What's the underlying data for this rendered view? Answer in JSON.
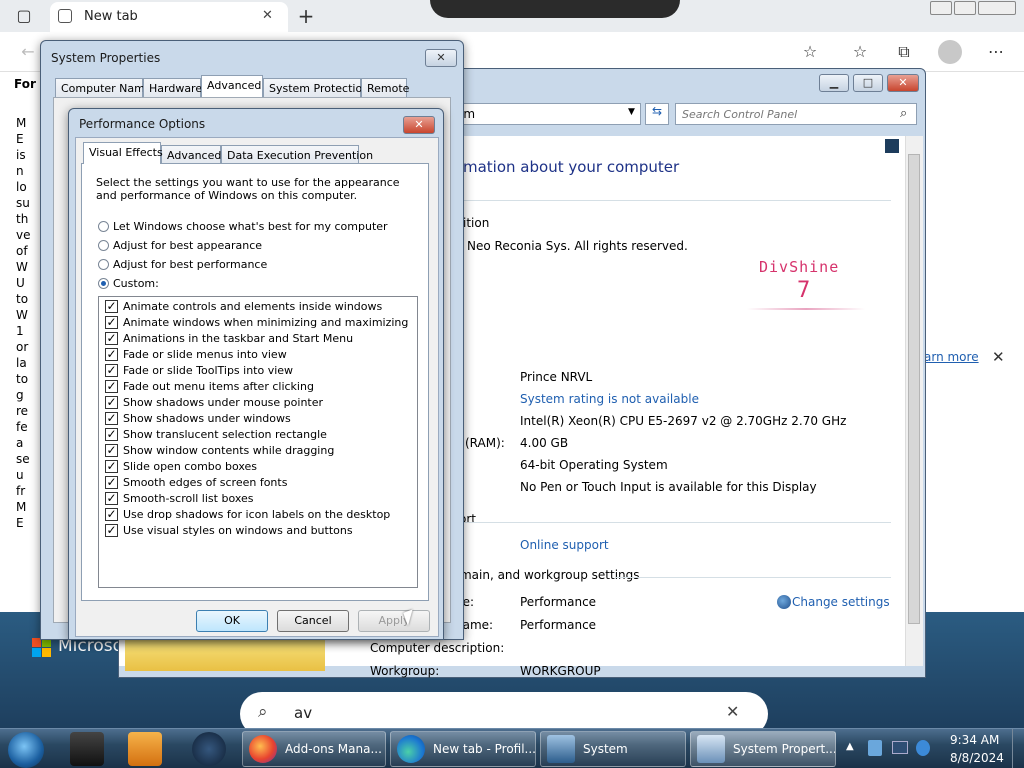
{
  "browser": {
    "tab_title": "New tab",
    "tab_close": "✕",
    "new_tab": "+",
    "favbar_text": "For c",
    "left_column": [
      "M",
      "E",
      "is",
      "n",
      "lo",
      "su",
      "th",
      "ve",
      "of",
      "W",
      "U",
      "to",
      "W",
      "1",
      "or",
      "la",
      "to",
      "g",
      "re",
      "fe",
      "a",
      "se",
      "u",
      "fr",
      "M",
      "E"
    ],
    "learn_more": "arn more",
    "close_x": "✕",
    "banner_brand": "Microso",
    "search_query": "av"
  },
  "control_panel": {
    "search_placeholder": "Search Control Panel",
    "address_fragment": "em",
    "heading": "mation about your computer",
    "edition_label": "ition",
    "copyright": "Neo Reconia Sys.  All rights reserved.",
    "logo_text": "DivShine",
    "logo_version": "7",
    "rows": [
      {
        "label": "",
        "value": "Prince NRVL",
        "link": false
      },
      {
        "label": "",
        "value": "System rating is not available",
        "link": true
      },
      {
        "label": "",
        "value": "Intel(R) Xeon(R) CPU E5-2697 v2 @ 2.70GHz   2.70 GHz",
        "link": false
      },
      {
        "label": "(RAM):",
        "value": "4.00 GB",
        "link": false
      },
      {
        "label": "",
        "value": "64-bit Operating System",
        "link": false
      },
      {
        "label": "",
        "value": "No Pen or Touch Input is available for this Display",
        "link": false
      }
    ],
    "support_label": "ort",
    "online_support": "Online support",
    "domain_section": "domain, and workgroup settings",
    "name_rows": [
      {
        "label": "ne:",
        "value": "Performance"
      },
      {
        "label": "name:",
        "value": "Performance"
      },
      {
        "label": "Computer description:",
        "value": ""
      },
      {
        "label": "Workgroup:",
        "value": "WORKGROUP"
      }
    ],
    "change_settings": "Change settings"
  },
  "system_properties": {
    "title": "System Properties",
    "tabs": [
      "Computer Name",
      "Hardware",
      "Advanced",
      "System Protection",
      "Remote"
    ],
    "selected_tab": "Advanced"
  },
  "performance_options": {
    "title": "Performance Options",
    "tabs": [
      "Visual Effects",
      "Advanced",
      "Data Execution Prevention"
    ],
    "selected_tab": "Visual Effects",
    "description": "Select the settings you want to use for the appearance and performance of Windows on this computer.",
    "radios": [
      {
        "label": "Let Windows choose what's best for my computer",
        "checked": false
      },
      {
        "label": "Adjust for best appearance",
        "checked": false
      },
      {
        "label": "Adjust for best performance",
        "checked": false
      },
      {
        "label": "Custom:",
        "checked": true
      }
    ],
    "effects": [
      "Animate controls and elements inside windows",
      "Animate windows when minimizing and maximizing",
      "Animations in the taskbar and Start Menu",
      "Fade or slide menus into view",
      "Fade or slide ToolTips into view",
      "Fade out menu items after clicking",
      "Show shadows under mouse pointer",
      "Show shadows under windows",
      "Show translucent selection rectangle",
      "Show window contents while dragging",
      "Slide open combo boxes",
      "Smooth edges of screen fonts",
      "Smooth-scroll list boxes",
      "Use drop shadows for icon labels on the desktop",
      "Use visual styles on windows and buttons"
    ],
    "ok": "OK",
    "cancel": "Cancel",
    "apply": "Apply"
  },
  "taskbar": {
    "items": [
      "Add-ons Mana...",
      "New tab - Profil...",
      "System",
      "System Propert..."
    ],
    "time": "9:34 AM",
    "date": "8/8/2024"
  },
  "colors": {
    "accent": "#1f5fb0",
    "logo": "#d6336c",
    "taskbar": "#1b3249"
  }
}
